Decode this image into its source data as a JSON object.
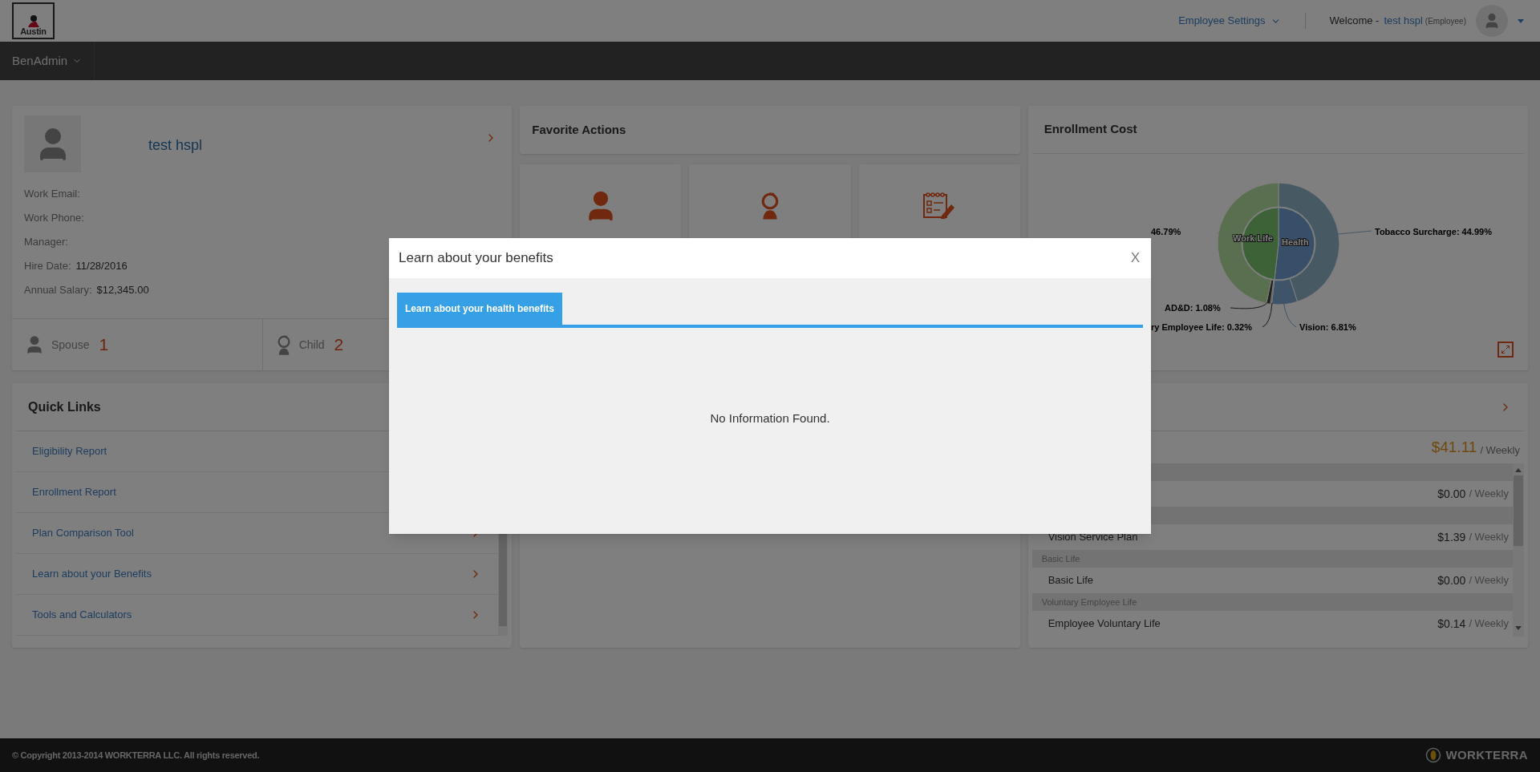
{
  "header": {
    "logo": "Austin",
    "settings_menu": "Employee Settings",
    "welcome_label": "Welcome -",
    "user_name": "test hspl",
    "user_role": "(Employee)"
  },
  "nav": {
    "menu": "BenAdmin"
  },
  "profile": {
    "name": "test hspl",
    "fields": [
      {
        "label": "Work Email:"
      },
      {
        "label": "Work Phone:"
      },
      {
        "label": "Manager:"
      },
      {
        "label": "Hire Date:",
        "value": "11/28/2016"
      },
      {
        "label": "Annual Salary:",
        "value": "$12,345.00"
      }
    ],
    "dependents": [
      {
        "kind": "spouse",
        "label": "Spouse",
        "count": "1"
      },
      {
        "kind": "child",
        "label": "Child",
        "count": "2"
      }
    ]
  },
  "favorite_actions": {
    "title": "Favorite Actions",
    "tiles": [
      {
        "kind": "person"
      },
      {
        "kind": "child"
      },
      {
        "kind": "form"
      }
    ]
  },
  "quick_links": {
    "title": "Quick Links",
    "items": [
      "Eligibility Report",
      "Enrollment Report",
      "Plan Comparison Tool",
      "Learn about your Benefits",
      "Tools and Calculators"
    ]
  },
  "enrollment_cost": {
    "title": "Enrollment Cost",
    "chart_data": {
      "type": "donut",
      "series": [
        {
          "values": [
            44.99,
            6.81,
            0.32,
            1.08,
            46.79
          ],
          "colors": [
            "#8fb4c8",
            "#7fa8d0",
            "#555555",
            "#444444",
            "#b4dca0"
          ]
        },
        {
          "values": [
            51.8,
            48.19
          ],
          "colors": [
            "#6f9fd0",
            "#7cc470"
          ]
        }
      ],
      "value_labels": [
        "Tobacco Surcharge: 44.99%",
        "Vision: 6.81%",
        "ry Employee Life: 0.32%",
        "AD&D: 1.08%",
        "46.79%"
      ],
      "annotations": [
        "Health",
        "Work Life"
      ]
    }
  },
  "elections": {
    "total": "$41.11",
    "total_period": "/ Weekly",
    "rows": [
      {
        "kind": "group"
      },
      {
        "kind": "plan",
        "amount": "$0.00",
        "period": "/ Weekly"
      },
      {
        "kind": "group"
      },
      {
        "kind": "plan",
        "name": "Vision Service Plan",
        "amount": "$1.39",
        "period": "/ Weekly"
      },
      {
        "kind": "group",
        "name": "Basic Life"
      },
      {
        "kind": "plan",
        "name": "Basic Life",
        "amount": "$0.00",
        "period": "/ Weekly"
      },
      {
        "kind": "group",
        "name": "Voluntary Employee Life"
      },
      {
        "kind": "plan",
        "name": "Employee Voluntary Life",
        "amount": "$0.14",
        "period": "/ Weekly"
      }
    ]
  },
  "modal": {
    "title": "Learn about your benefits",
    "close": "X",
    "tabs": [
      {
        "label": "Learn about your health benefits",
        "selected": true
      }
    ],
    "message": "No Information Found."
  },
  "footer": {
    "copyright": "© Copyright 2013-2014 WORKTERRA LLC. All rights reserved.",
    "brand": "WORKTERRA"
  }
}
